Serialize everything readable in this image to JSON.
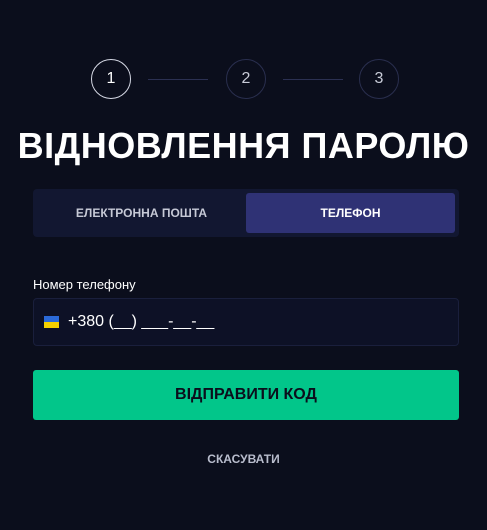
{
  "stepper": {
    "steps": [
      {
        "label": "1",
        "active": true
      },
      {
        "label": "2",
        "active": false
      },
      {
        "label": "3",
        "active": false
      }
    ]
  },
  "title": "ВІДНОВЛЕННЯ ПАРОЛЮ",
  "tabs": {
    "email": "ЕЛЕКТРОННА ПОШТА",
    "phone": "ТЕЛЕФОН",
    "selected": "phone"
  },
  "phone_field": {
    "label": "Номер телефону",
    "placeholder": "+380 (__) ___-__-__",
    "value": "",
    "flag_icon": "ukraine-flag-icon",
    "flag_colors": {
      "top": "#2b6ad9",
      "bottom": "#f5d000"
    }
  },
  "submit_label": "ВІДПРАВИТИ КОД",
  "cancel_label": "СКАСУВАТИ",
  "colors": {
    "background": "#0b0e1c",
    "accent": "#02c68a",
    "tab_active": "#2f3275"
  }
}
